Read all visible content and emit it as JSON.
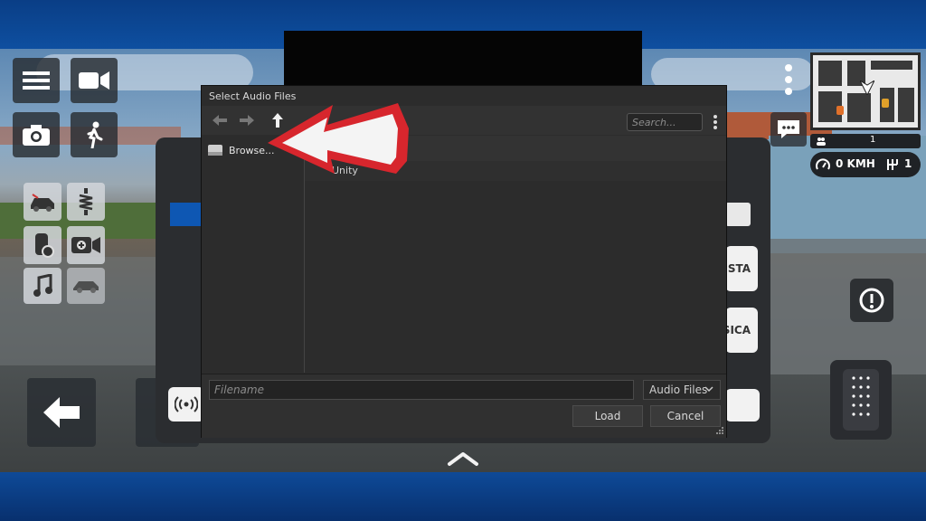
{
  "dialog": {
    "title": "Select Audio Files",
    "search_placeholder": "Search...",
    "sidebar_item": "Browse...",
    "list_item": "Unity",
    "filename_placeholder": "Filename",
    "filetype_selected": "Audio Files",
    "load_label": "Load",
    "cancel_label": "Cancel"
  },
  "panel": {
    "pill_top": "STA",
    "pill_bottom": "SICA"
  },
  "hud": {
    "players_count": "1",
    "speed": "0 KMH",
    "gear": "1"
  },
  "icons": [
    "menu-icon",
    "video-camera-icon",
    "camera-icon",
    "walk-icon",
    "car-door-icon",
    "suspension-icon",
    "car-settings-icon",
    "camera-add-icon",
    "music-icon",
    "car-icon",
    "back-arrow-icon",
    "chat-icon",
    "hazard-icon",
    "pedal-icon",
    "broadcast-icon",
    "folder-back-icon",
    "folder-forward-icon",
    "folder-up-icon",
    "drive-icon",
    "kebab-icon",
    "chevron-down-icon",
    "chevron-up-icon"
  ],
  "colors": {
    "frame_blue": "#0e4fa0",
    "dialog_bg": "#2c2c2c",
    "arrow_red": "#d7262d"
  }
}
